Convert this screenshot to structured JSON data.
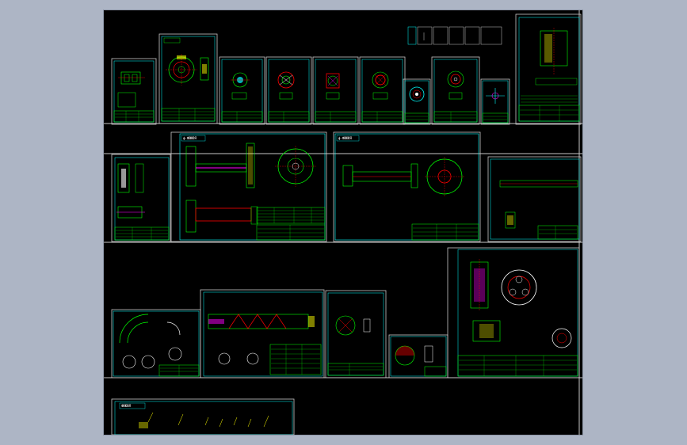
{
  "canvas": {
    "background": "#000000",
    "frame_color": "#c8c8c8",
    "border_color": "#00ffff",
    "geometry_color": "#00ff00",
    "section_color": "#ff0000",
    "hatch_color": "#ff00ff",
    "dimension_color": "#ffff00"
  },
  "labels": {
    "assembly_a": "ф-ФЮЮЮЯ",
    "assembly_b": "ф-ФЮЮЮЯ",
    "assembly_c": "ФЮЮЮЯ"
  }
}
